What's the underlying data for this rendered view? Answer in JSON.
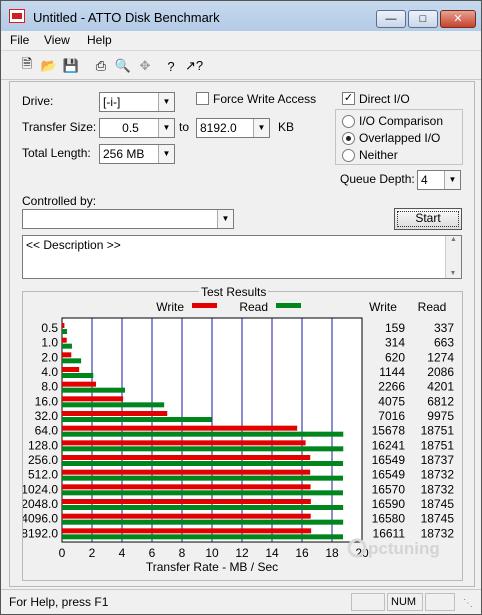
{
  "window": {
    "title": "Untitled - ATTO Disk Benchmark"
  },
  "menu": {
    "file": "File",
    "view": "View",
    "help": "Help"
  },
  "toolbar": {
    "icons": [
      "new-icon",
      "open-icon",
      "save-icon",
      "print-icon",
      "print-preview-icon",
      "move-icon",
      "help-icon",
      "context-help-icon"
    ]
  },
  "form": {
    "drive_label": "Drive:",
    "drive_value": "[-i-]",
    "force_write_label": "Force Write Access",
    "force_write_checked": false,
    "direct_io_label": "Direct I/O",
    "direct_io_checked": true,
    "transfer_size_label": "Transfer Size:",
    "transfer_from": "0.5",
    "to_label": "to",
    "transfer_to": "8192.0",
    "kb_label": "KB",
    "total_length_label": "Total Length:",
    "total_length_value": "256 MB",
    "io_options": [
      "I/O Comparison",
      "Overlapped I/O",
      "Neither"
    ],
    "io_selected": "Overlapped I/O",
    "queue_depth_label": "Queue Depth:",
    "queue_depth_value": "4",
    "controlled_by_label": "Controlled by:",
    "controlled_by_value": "",
    "start_label": "Start",
    "description": "<< Description >>"
  },
  "results": {
    "title": "Test Results",
    "legend_write": "Write",
    "legend_read": "Read",
    "col_write": "Write",
    "col_read": "Read",
    "write_color": "#e30000",
    "read_color": "#00861c",
    "grid_color": "#1a1aa6"
  },
  "chart_data": {
    "type": "bar",
    "orientation": "horizontal",
    "categories": [
      "0.5",
      "1.0",
      "2.0",
      "4.0",
      "8.0",
      "16.0",
      "32.0",
      "64.0",
      "128.0",
      "256.0",
      "512.0",
      "1024.0",
      "2048.0",
      "4096.0",
      "8192.0"
    ],
    "series": [
      {
        "name": "Write",
        "values": [
          159,
          314,
          620,
          1144,
          2266,
          4075,
          7016,
          15678,
          16241,
          16549,
          16549,
          16570,
          16590,
          16580,
          16611
        ]
      },
      {
        "name": "Read",
        "values": [
          337,
          663,
          1274,
          2086,
          4201,
          6812,
          9975,
          18751,
          18751,
          18737,
          18732,
          18732,
          18745,
          18745,
          18732
        ]
      }
    ],
    "x_ticks": [
      "0",
      "2",
      "4",
      "6",
      "8",
      "10",
      "12",
      "14",
      "16",
      "18",
      "20"
    ],
    "xlim": [
      0,
      20000
    ],
    "xlabel": "Transfer Rate - MB / Sec"
  },
  "watermark": "pctuning",
  "status": {
    "text": "For Help, press F1",
    "num": "NUM"
  }
}
